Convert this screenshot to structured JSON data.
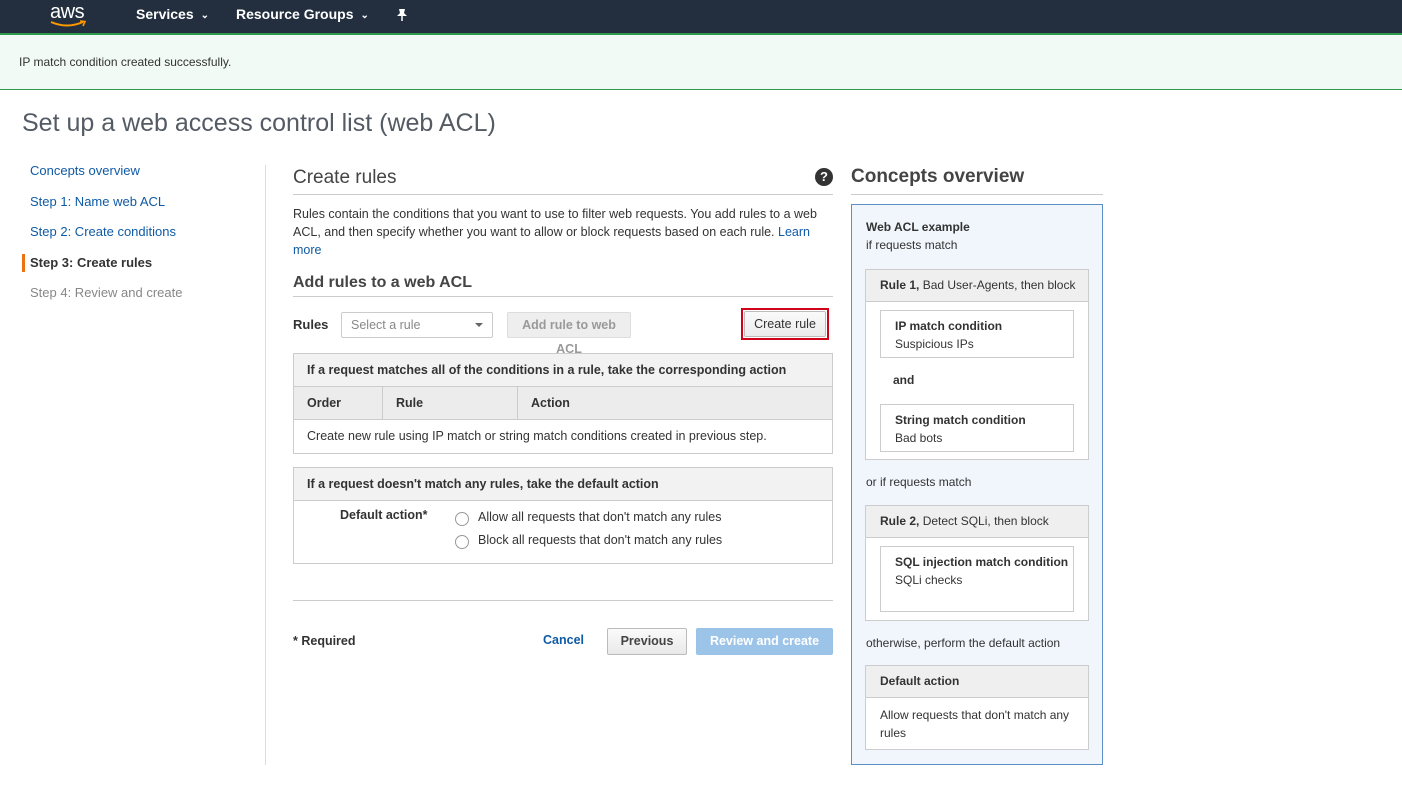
{
  "topnav": {
    "logo_text": "aws",
    "services_label": "Services",
    "resource_groups_label": "Resource Groups",
    "pin_icon": "pin-icon",
    "chevron_icon": "chevron-down-icon"
  },
  "flash": {
    "message": "IP match condition created successfully."
  },
  "page_title": "Set up a web access control list (web ACL)",
  "sidenav": {
    "items": [
      {
        "label": "Concepts overview"
      },
      {
        "label": "Step 1: Name web ACL"
      },
      {
        "label": "Step 2: Create conditions"
      },
      {
        "label": "Step 3: Create rules"
      },
      {
        "label": "Step 4: Review and create"
      }
    ]
  },
  "main": {
    "heading": "Create rules",
    "help_icon": "?",
    "description": "Rules contain the conditions that you want to use to filter web requests. You add rules to a web ACL, and then specify whether you want to allow or block requests based on each rule.",
    "learn_more": "Learn more",
    "add_heading": "Add rules to a web ACL",
    "rules_label": "Rules",
    "select_placeholder": "Select a rule",
    "add_rule_button": "Add rule to web ACL",
    "create_rule_button": "Create rule",
    "match_table": {
      "header": "If a request matches all of the conditions in a rule, take the corresponding action",
      "columns": [
        "Order",
        "Rule",
        "Action"
      ],
      "empty_message": "Create new rule using IP match or string match conditions created in previous step."
    },
    "default_table": {
      "header": "If a request doesn't match any rules, take the default action",
      "default_action_label": "Default action*",
      "options": [
        "Allow all requests that don't match any rules",
        "Block all requests that don't match any rules"
      ]
    },
    "required_note": "* Required",
    "cancel_button": "Cancel",
    "previous_button": "Previous",
    "review_button": "Review and create"
  },
  "concepts": {
    "title": "Concepts overview",
    "example_title": "Web ACL example",
    "if_match": "if requests match",
    "rule1": {
      "name": "Rule 1,",
      "rest": "Bad User-Agents, then block"
    },
    "cond1": {
      "title": "IP match condition",
      "sub": "Suspicious IPs"
    },
    "and_text": "and",
    "cond2": {
      "title": "String match condition",
      "sub": "Bad bots"
    },
    "or_match": "or if requests match",
    "rule2": {
      "name": "Rule 2,",
      "rest": "Detect SQLi, then block"
    },
    "cond3": {
      "title": "SQL injection match condition",
      "sub": "SQLi checks"
    },
    "otherwise": "otherwise, perform the default action",
    "default_box": {
      "title": "Default action",
      "text": "Allow requests that don't match any rules"
    }
  },
  "colors": {
    "nav_bg": "#232f3e",
    "link": "#0f5aa5",
    "active_marker": "#ec7211",
    "success_border": "#2d9a4d",
    "highlight": "#d0021b",
    "primary_disabled": "#9cc4e8"
  }
}
